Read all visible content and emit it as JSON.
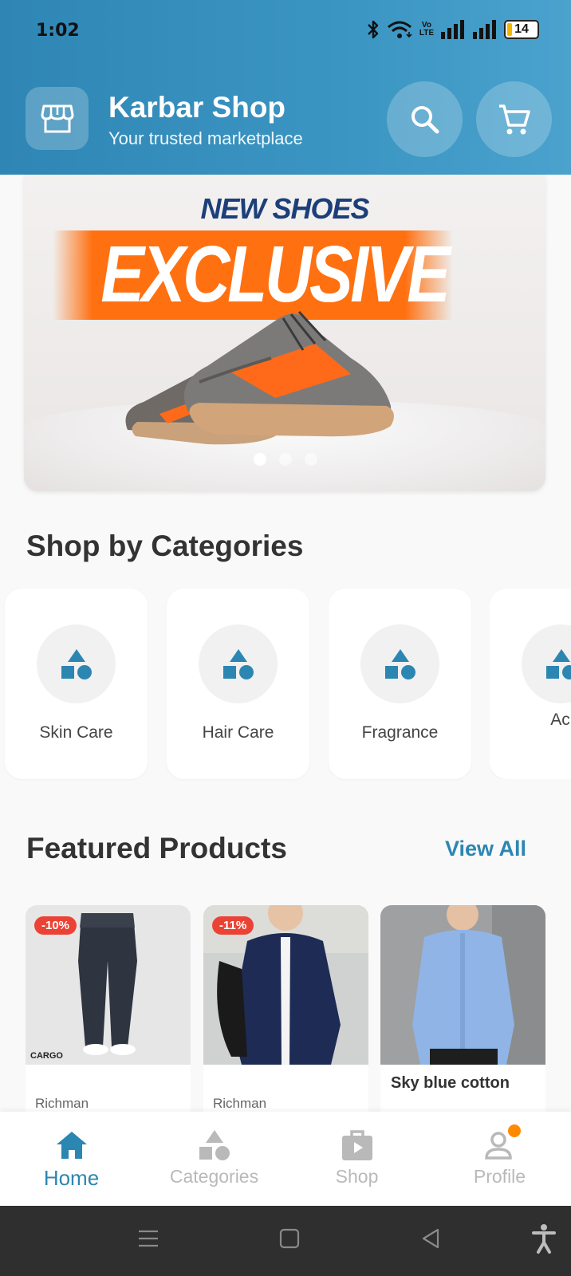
{
  "status_bar": {
    "time": "1:02",
    "volte_top": "Vo",
    "volte_bottom": "LTE",
    "battery": "14"
  },
  "header": {
    "title": "Karbar Shop",
    "subtitle": "Your trusted marketplace",
    "icons": [
      "store-icon",
      "search-icon",
      "cart-icon"
    ]
  },
  "banner": {
    "kicker": "NEW SHOES",
    "headline": "EXCLUSIVE",
    "slides": 3,
    "active_slide": 1
  },
  "categories": {
    "title": "Shop by Categories",
    "items": [
      {
        "label": "Skin Care"
      },
      {
        "label": "Hair Care"
      },
      {
        "label": "Fragrance"
      },
      {
        "label": "Acne & Agin"
      }
    ]
  },
  "featured": {
    "title": "Featured Products",
    "view_all": "View All",
    "products": [
      {
        "discount": "-10%",
        "name": "",
        "brand": "Richman",
        "image": "cargo-pants-photo"
      },
      {
        "discount": "-11%",
        "name": "",
        "brand": "Richman",
        "image": "navy-shirt-photo"
      },
      {
        "discount": "",
        "name": "Sky blue cotton",
        "brand": "",
        "image": "blue-shirt-photo"
      }
    ]
  },
  "bottom_nav": {
    "items": [
      {
        "label": "Home",
        "icon": "home-icon",
        "active": true
      },
      {
        "label": "Categories",
        "icon": "categories-icon",
        "active": false
      },
      {
        "label": "Shop",
        "icon": "shop-bag-icon",
        "active": false
      },
      {
        "label": "Profile",
        "icon": "profile-icon",
        "active": false
      }
    ]
  },
  "colors": {
    "accent": "#2c86b2",
    "header_start": "#2f86b5",
    "discount": "#ea4336",
    "notification": "#ff8a00"
  }
}
